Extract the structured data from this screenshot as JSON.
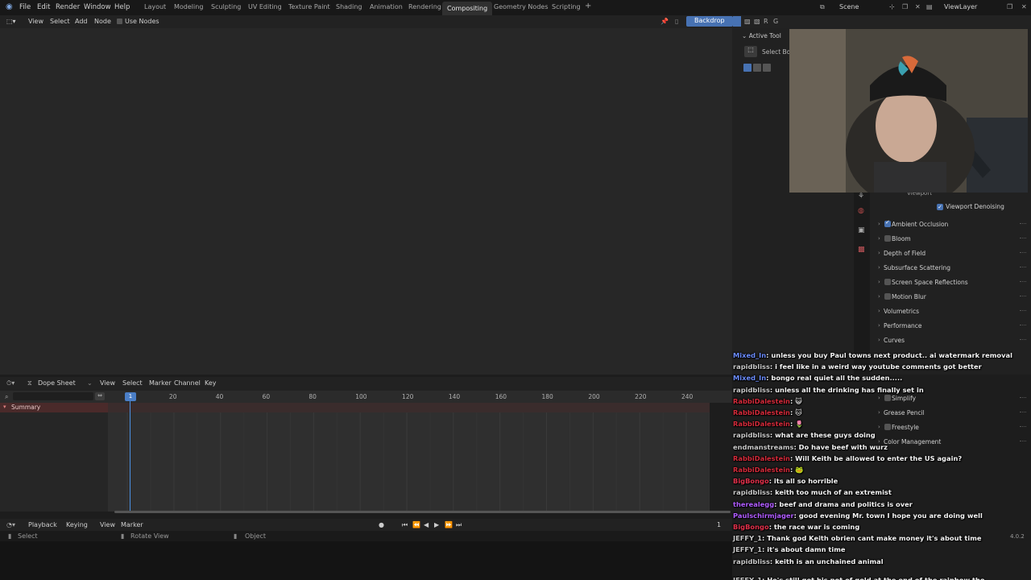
{
  "menu": {
    "items": [
      "File",
      "Edit",
      "Render",
      "Window",
      "Help"
    ]
  },
  "workspaces": [
    "Layout",
    "Modeling",
    "Sculpting",
    "UV Editing",
    "Texture Paint",
    "Shading",
    "Animation",
    "Rendering",
    "Compositing",
    "Geometry Nodes",
    "Scripting"
  ],
  "active_workspace": "Compositing",
  "scene": {
    "scene_name": "Scene",
    "view_layer": "ViewLayer"
  },
  "node_editor": {
    "menus": [
      "View",
      "Select",
      "Add",
      "Node"
    ],
    "use_nodes_label": "Use Nodes",
    "backdrop_label": "Backdrop"
  },
  "tool_panel": {
    "title": "Active Tool",
    "tool_label": "Select Bo"
  },
  "properties": {
    "viewport_label": "Viewport",
    "viewport_denoising": "Viewport Denoising",
    "rows": [
      {
        "label": "Ambient Occlusion",
        "checkbox": true,
        "checked": true
      },
      {
        "label": "Bloom",
        "checkbox": true,
        "checked": false
      },
      {
        "label": "Depth of Field",
        "checkbox": false
      },
      {
        "label": "Subsurface Scattering",
        "checkbox": false
      },
      {
        "label": "Screen Space Reflections",
        "checkbox": true,
        "checked": false
      },
      {
        "label": "Motion Blur",
        "checkbox": true,
        "checked": false
      },
      {
        "label": "Volumetrics",
        "checkbox": false
      },
      {
        "label": "Performance",
        "checkbox": false
      },
      {
        "label": "Curves",
        "checkbox": false
      },
      {
        "label": "Simplify",
        "checkbox": true,
        "checked": false
      },
      {
        "label": "Grease Pencil",
        "checkbox": false
      },
      {
        "label": "Freestyle",
        "checkbox": true,
        "checked": false
      },
      {
        "label": "Color Management",
        "checkbox": false
      }
    ]
  },
  "dope_sheet": {
    "mode": "Dope Sheet",
    "menus": [
      "View",
      "Select",
      "Marker",
      "Channel",
      "Key"
    ],
    "ticks": [
      "20",
      "40",
      "60",
      "80",
      "100",
      "120",
      "140",
      "160",
      "180",
      "200",
      "220",
      "240"
    ],
    "current_frame": "1",
    "summary_label": "Summary"
  },
  "timeline": {
    "menus": [
      "Playback",
      "Keying",
      "View",
      "Marker"
    ],
    "frame": "1"
  },
  "status_bar": {
    "select": "Select",
    "rotate": "Rotate View",
    "object": "Object",
    "version": "4.0.2"
  },
  "chat": [
    {
      "user": "Mixed_In",
      "color": "#6b8cff",
      "msg": ": unless you buy Paul towns next product.. ai watermark removal"
    },
    {
      "user": "rapidbliss",
      "color": "#c8c8c8",
      "msg": ": i feel like in a weird way youtube comments got better"
    },
    {
      "user": "Mixed_In",
      "color": "#6b8cff",
      "msg": ": bongo real quiet all the sudden....."
    },
    {
      "user": "rapidbliss",
      "color": "#c8c8c8",
      "msg": ": unless all the drinking has finally set in"
    },
    {
      "user": "RabbiDalestein",
      "color": "#d42a3a",
      "msg": ": 😺"
    },
    {
      "user": "RabbiDalestein",
      "color": "#d42a3a",
      "msg": ": 🐱"
    },
    {
      "user": "RabbiDalestein",
      "color": "#d42a3a",
      "msg": ": 🌷"
    },
    {
      "user": "rapidbliss",
      "color": "#c8c8c8",
      "msg": ": what are these guys doing"
    },
    {
      "user": "endmanstreams",
      "color": "#c8c8c8",
      "msg": ": Do have beef with wurz"
    },
    {
      "user": "RabbiDalestein",
      "color": "#d42a3a",
      "msg": ": Will Keith be allowed to enter the US again?"
    },
    {
      "user": "RabbiDalestein",
      "color": "#d42a3a",
      "msg": ": 🐸"
    },
    {
      "user": "BigBongo",
      "color": "#e0304a",
      "msg": ": its all so horrible"
    },
    {
      "user": "rapidbliss",
      "color": "#c8c8c8",
      "msg": ": keith too much of an extremist"
    },
    {
      "user": "therealegg",
      "color": "#b05cff",
      "msg": ": beef and drama and politics is over"
    },
    {
      "user": "Paulschirmjager",
      "color": "#b05cff",
      "msg": ": good evening Mr. town I hope you are doing well"
    },
    {
      "user": "BigBongo",
      "color": "#e0304a",
      "msg": ": the race war is coming"
    },
    {
      "user": "JEFFY_1",
      "color": "#c8c8c8",
      "msg": ": Thank god Keith obrien cant make money it's about time"
    },
    {
      "user": "JEFFY_1",
      "color": "#c8c8c8",
      "msg": ": it's about damn time"
    },
    {
      "user": "rapidbliss",
      "color": "#c8c8c8",
      "msg": ": keith is an unchained animal"
    },
    {
      "user": "JEFFY_1",
      "color": "#c8c8c8",
      "msg": ": He's still got his pot of gold at the end of the rainbow tho"
    }
  ]
}
